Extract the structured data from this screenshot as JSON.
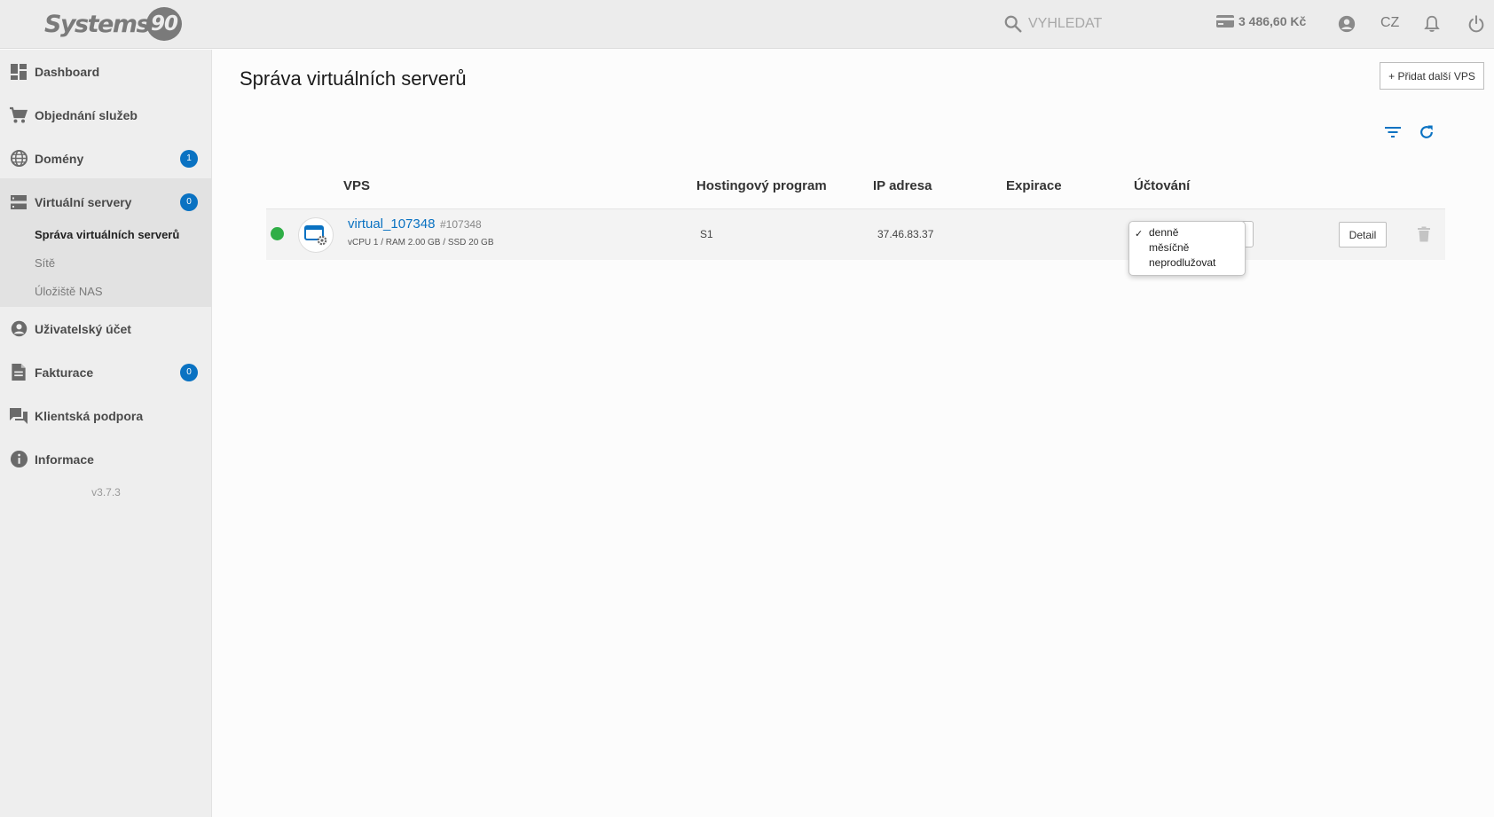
{
  "header": {
    "logo_text": "Systems",
    "logo_number": "90",
    "search_placeholder": "VYHLEDAT",
    "credit": "3 486,60 Kč",
    "language": "CZ"
  },
  "sidebar": {
    "items": [
      {
        "label": "Dashboard",
        "icon": "dashboard-icon"
      },
      {
        "label": "Objednání služeb",
        "icon": "cart-icon"
      },
      {
        "label": "Domény",
        "icon": "globe-icon",
        "badge": "1"
      },
      {
        "label": "Virtuální servery",
        "icon": "server-icon",
        "badge": "0"
      },
      {
        "label": "Uživatelský účet",
        "icon": "account-icon"
      },
      {
        "label": "Fakturace",
        "icon": "document-icon",
        "badge": "0"
      },
      {
        "label": "Klientská podpora",
        "icon": "chat-icon"
      },
      {
        "label": "Informace",
        "icon": "info-icon"
      }
    ],
    "subitems": [
      {
        "label": "Správa virtuálních serverů",
        "active": true
      },
      {
        "label": "Sítě"
      },
      {
        "label": "Úložiště NAS"
      }
    ],
    "version": "v3.7.3"
  },
  "main": {
    "title": "Správa virtuálních serverů",
    "add_button": "+ Přidat další VPS",
    "columns": [
      "VPS",
      "Hostingový program",
      "IP adresa",
      "Expirace",
      "Účtování"
    ],
    "rows": [
      {
        "name": "virtual_107348",
        "id": "#107348",
        "spec": "vCPU 1 / RAM 2.00 GB / SSD 20 GB",
        "program": "S1",
        "ip": "37.46.83.37",
        "expiration": "",
        "status": "online",
        "billing_options": [
          "denně",
          "měsíčně",
          "neprodlužovat"
        ],
        "billing_selected": "denně",
        "detail_label": "Detail"
      }
    ]
  },
  "colors": {
    "accent": "#0a72c2",
    "status_online": "#2fae46"
  }
}
